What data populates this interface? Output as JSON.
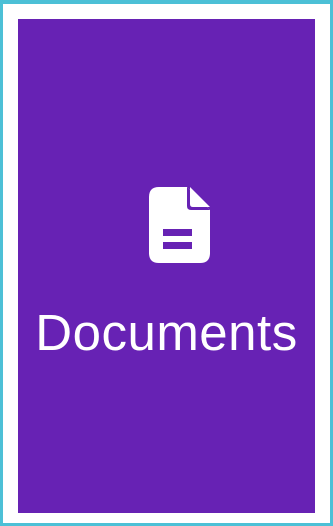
{
  "tile": {
    "label": "Documents",
    "icon": "document-icon",
    "background_color": "#6722b4",
    "frame_color": "#4cc0d6",
    "text_color": "#ffffff"
  }
}
